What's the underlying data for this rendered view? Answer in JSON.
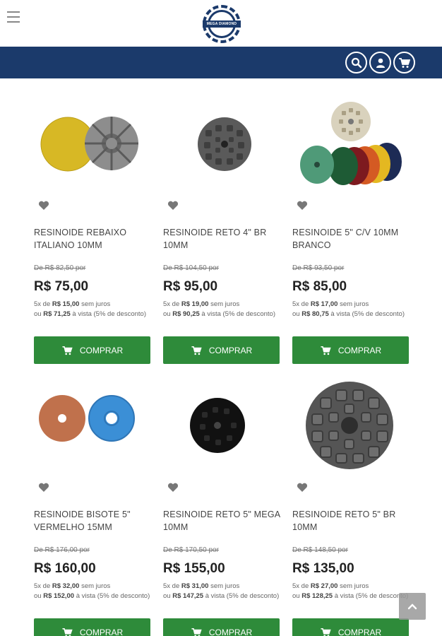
{
  "header": {
    "logo_text": "MEGA DIAMOND"
  },
  "products": [
    {
      "name": "RESINOIDE REBAIXO ITALIANO 10MM",
      "old_price": "De R$ 82,50 por",
      "price": "R$ 75,00",
      "installments": "5x de",
      "installment_value": "R$ 15,00",
      "installment_suffix": "sem juros",
      "cash_prefix": "ou",
      "cash_value": "R$ 71,25",
      "cash_suffix": "à vista (5% de desconto)",
      "button": "COMPRAR"
    },
    {
      "name": "RESINOIDE RETO 4\" BR 10MM",
      "old_price": "De R$ 104,50 por",
      "price": "R$ 95,00",
      "installments": "5x de",
      "installment_value": "R$ 19,00",
      "installment_suffix": "sem juros",
      "cash_prefix": "ou",
      "cash_value": "R$ 90,25",
      "cash_suffix": "à vista (5% de desconto)",
      "button": "COMPRAR"
    },
    {
      "name": "RESINOIDE 5\" C/V 10MM BRANCO",
      "old_price": "De R$ 93,50 por",
      "price": "R$ 85,00",
      "installments": "5x de",
      "installment_value": "R$ 17,00",
      "installment_suffix": "sem juros",
      "cash_prefix": "ou",
      "cash_value": "R$ 80,75",
      "cash_suffix": "à vista (5% de desconto)",
      "button": "COMPRAR"
    },
    {
      "name": "RESINOIDE BISOTE 5\" VERMELHO 15MM",
      "old_price": "De R$ 176,00 por",
      "price": "R$ 160,00",
      "installments": "5x de",
      "installment_value": "R$ 32,00",
      "installment_suffix": "sem juros",
      "cash_prefix": "ou",
      "cash_value": "R$ 152,00",
      "cash_suffix": "à vista (5% de desconto)",
      "button": "COMPRAR"
    },
    {
      "name": "RESINOIDE RETO 5\" MEGA 10MM",
      "old_price": "De R$ 170,50 por",
      "price": "R$ 155,00",
      "installments": "5x de",
      "installment_value": "R$ 31,00",
      "installment_suffix": "sem juros",
      "cash_prefix": "ou",
      "cash_value": "R$ 147,25",
      "cash_suffix": "à vista (5% de desconto)",
      "button": "COMPRAR"
    },
    {
      "name": "RESINOIDE RETO 5\" BR 10MM",
      "old_price": "De R$ 148,50 por",
      "price": "R$ 135,00",
      "installments": "5x de",
      "installment_value": "R$ 27,00",
      "installment_suffix": "sem juros",
      "cash_prefix": "ou",
      "cash_value": "R$ 128,25",
      "cash_suffix": "à vista (5% de desconto)",
      "button": "COMPRAR"
    }
  ],
  "colors": {
    "nav": "#1b3a6b",
    "button": "#2e8b3a"
  }
}
